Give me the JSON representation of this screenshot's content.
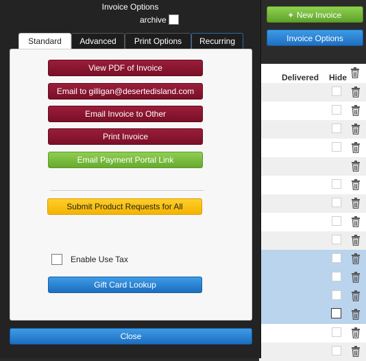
{
  "modal": {
    "title": "Invoice Options",
    "archive_label": "archive",
    "tabs": [
      "Standard",
      "Advanced",
      "Print Options",
      "Recurring"
    ],
    "active_tab": "Standard",
    "buttons": {
      "view_pdf": "View PDF of Invoice",
      "email_to": "Email to gilligan@desertedisland.com",
      "email_other": "Email Invoice to Other",
      "print": "Print Invoice",
      "payment_portal": "Email Payment Portal Link",
      "submit_requests": "Submit Product Requests for All",
      "gift_card": "Gift Card Lookup"
    },
    "enable_use_tax_label": "Enable Use Tax",
    "close_label": "Close"
  },
  "background": {
    "new_invoice_label": "New Invoice",
    "invoice_options_label": "Invoice Options",
    "columns": {
      "delivered": "Delivered",
      "hide": "Hide"
    }
  },
  "colors": {
    "red_button": "#8a1530",
    "green_button": "#7cbd41",
    "yellow_button": "#f9c10a",
    "blue_button": "#2a84d6",
    "selected_row": "#b9d4ec"
  },
  "icons": [
    "plus-icon",
    "trash-icon",
    "checkbox"
  ]
}
